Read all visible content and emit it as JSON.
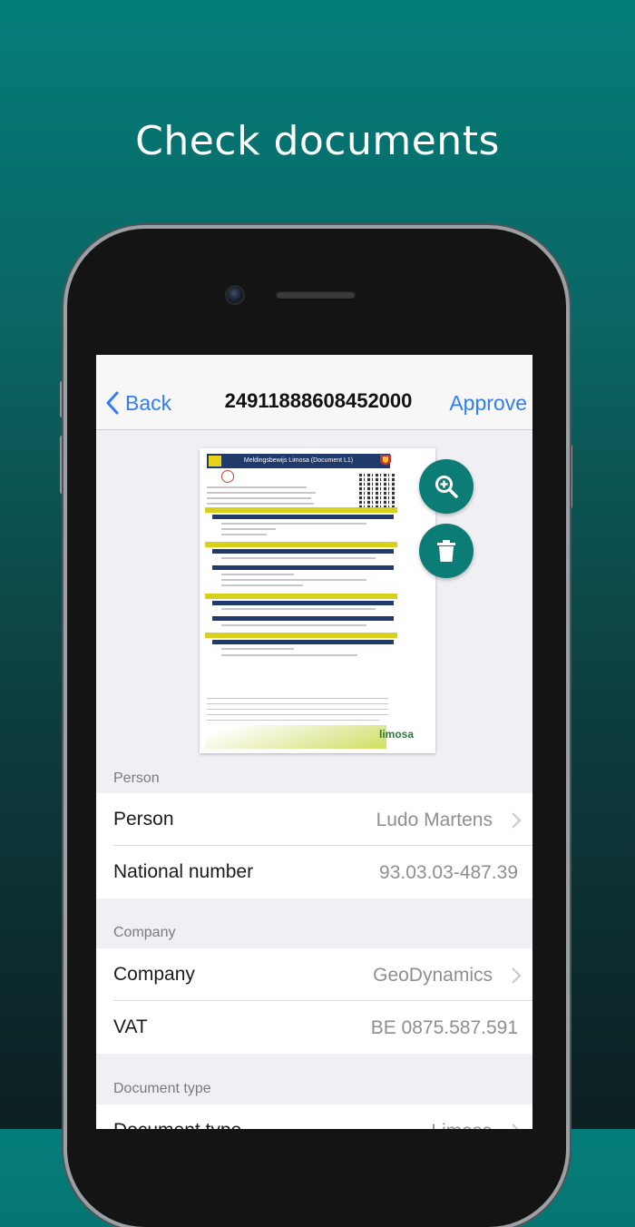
{
  "headline": "Check documents",
  "navbar": {
    "back_label": "Back",
    "title": "24911888608452000",
    "approve_label": "Approve"
  },
  "document_preview": {
    "header_text": "Meldingsbewijs Limosa (Document L1)",
    "brand": "limosa"
  },
  "sections": {
    "person": {
      "header": "Person",
      "rows": [
        {
          "label": "Person",
          "value": "Ludo Martens"
        },
        {
          "label": "National number",
          "value": "93.03.03-487.39"
        }
      ]
    },
    "company": {
      "header": "Company",
      "rows": [
        {
          "label": "Company",
          "value": "GeoDynamics"
        },
        {
          "label": "VAT",
          "value": "BE 0875.587.591"
        }
      ]
    },
    "document_type": {
      "header": "Document type",
      "rows": [
        {
          "label": "Document type",
          "value": "Limosa"
        }
      ]
    }
  },
  "colors": {
    "accent_blue": "#2f7ef6",
    "fab_teal": "#0c7c76"
  },
  "icons": {
    "back": "chevron-left-icon",
    "zoom": "zoom-in-icon",
    "delete": "trash-icon",
    "disclosure": "chevron-right-icon"
  }
}
